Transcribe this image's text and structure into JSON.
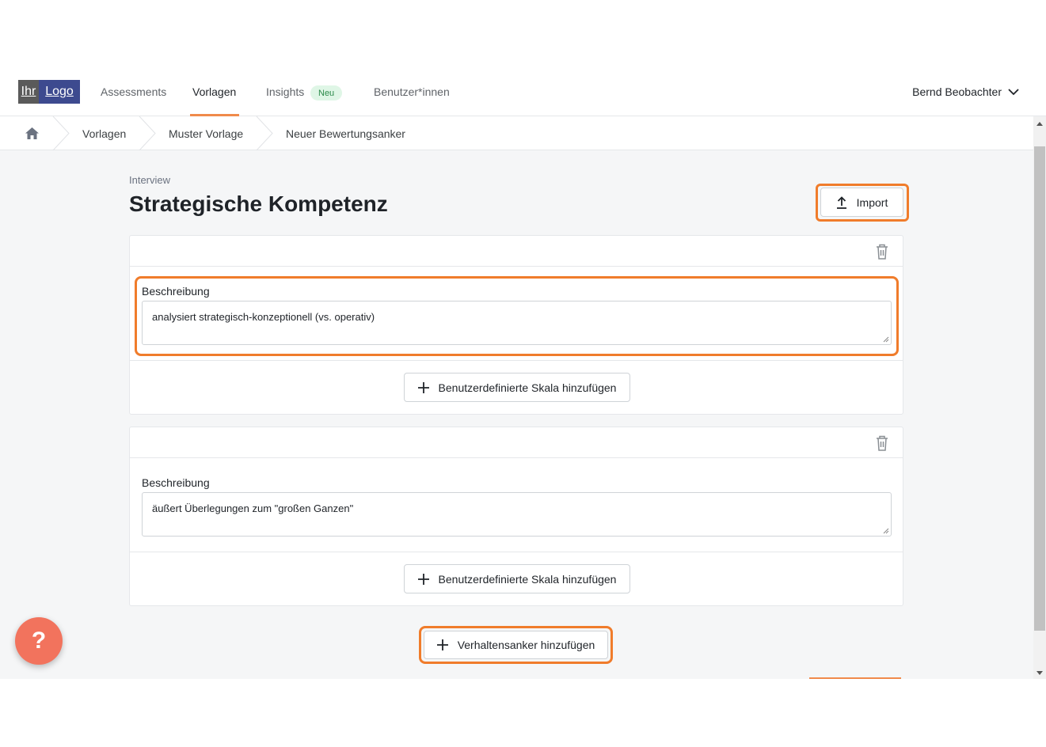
{
  "logo": {
    "part1": "Ihr",
    "part2": "Logo"
  },
  "nav": {
    "items": [
      {
        "label": "Assessments"
      },
      {
        "label": "Vorlagen"
      },
      {
        "label": "Insights"
      },
      {
        "label": "Benutzer*innen"
      }
    ],
    "badge": "Neu",
    "active": "Vorlagen",
    "user": "Bernd Beobachter"
  },
  "breadcrumb": [
    "Vorlagen",
    "Muster Vorlage",
    "Neuer Bewertungsanker"
  ],
  "header": {
    "section": "Interview",
    "title": "Strategische Kompetenz",
    "import_label": "Import"
  },
  "cards": [
    {
      "field_label": "Beschreibung",
      "value": "analysiert strategisch-konzeptionell (vs. operativ)",
      "add_scale_label": "Benutzerdefinierte Skala hinzufügen"
    },
    {
      "field_label": "Beschreibung",
      "value": "äußert Überlegungen zum \"großen Ganzen\"",
      "add_scale_label": "Benutzerdefinierte Skala hinzufügen"
    }
  ],
  "add_anchor_label": "Verhaltensanker hinzufügen",
  "help": "?",
  "colors": {
    "accent": "#f07c2b",
    "help": "#f2735d",
    "badge_bg": "#dff6e6",
    "badge_fg": "#2b8a4a"
  }
}
